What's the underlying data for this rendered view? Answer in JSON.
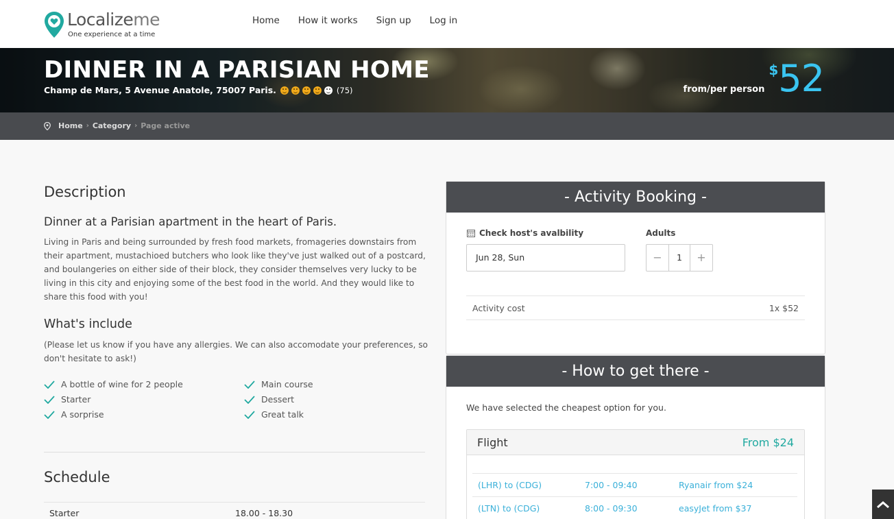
{
  "brand": {
    "name_part1": "Localize",
    "name_part2": "me",
    "tagline": "One experience at a time",
    "accent_color": "#21a9a0"
  },
  "nav": {
    "items": [
      {
        "label": "Home"
      },
      {
        "label": "How it works"
      },
      {
        "label": "Sign up"
      },
      {
        "label": "Log in"
      }
    ]
  },
  "hero": {
    "title": "DINNER IN A PARISIAN HOME",
    "address": "Champ de Mars, 5 Avenue Anatole, 75007 Paris.",
    "rating_filled": 4,
    "rating_total": 5,
    "reviews": "(75)",
    "price_label": "from/per person",
    "price_currency": "$",
    "price_value": "52",
    "price_color": "#3ac4f0"
  },
  "breadcrumb": {
    "items": [
      "Home",
      "Category"
    ],
    "active": "Page active"
  },
  "description": {
    "heading": "Description",
    "subheading": "Dinner at a Parisian apartment in the heart of Paris.",
    "body": "Living in Paris and being surrounded by fresh food markets, fromageries downstairs from their apartment, mustachioed butchers who look like they've just walked out of a postcard, and boulangeries on either side of their block, they consider themselves very lucky to be living in this city and enjoying some of the best food in the world. And they would like to share this food with you!"
  },
  "includes": {
    "heading": "What's include",
    "note": "(Please let us know if you have any allergies. We can also accomodate your preferences, so don't hesitate to ask!)",
    "left": [
      "A bottle of wine for 2 people",
      "Starter",
      "A sorprise"
    ],
    "right": [
      "Main course",
      "Dessert",
      "Great talk"
    ]
  },
  "schedule": {
    "heading": "Schedule",
    "rows": [
      {
        "item": "Starter",
        "time": "18.00 - 18.30"
      }
    ]
  },
  "booking": {
    "heading": "- Activity Booking -",
    "availability_label": "Check host's avalbility",
    "date_value": "Jun 28, Sun",
    "adults_label": "Adults",
    "adults_value": "1",
    "minus": "−",
    "plus": "+",
    "cost_label": "Activity cost",
    "cost_value": "1x $52"
  },
  "getthere": {
    "heading": "- How to get there -",
    "note": "We have selected the cheapest option for you.",
    "flight_title": "Flight",
    "flight_from": "From $24",
    "flights": [
      {
        "route": "(LHR) to (CDG)",
        "time": "7:00 - 09:40",
        "carrier": "Ryanair from $24"
      },
      {
        "route": "(LTN) to (CDG)",
        "time": "8:00 - 09:30",
        "carrier": "easyJet from $37"
      }
    ]
  }
}
